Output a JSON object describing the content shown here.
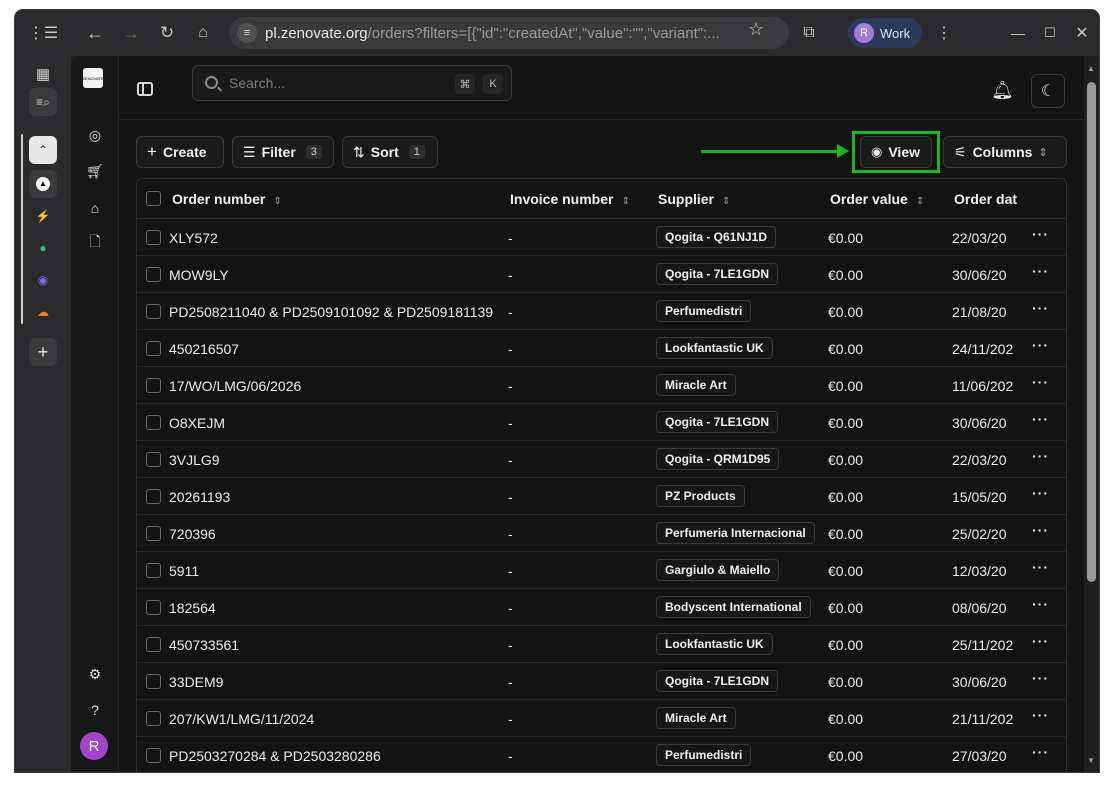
{
  "browser": {
    "url_host": "pl.zenovate.org",
    "url_path": "/orders?filters=[{\"id\":\"createdAt\",\"value\":\"\",\"variant\":...",
    "profile_initial": "R",
    "profile_name": "Work"
  },
  "app": {
    "search_placeholder": "Search...",
    "kbd_cmd": "⌘",
    "kbd_k": "K",
    "user_initial": "R"
  },
  "toolbar": {
    "create_label": "Create",
    "filter_label": "Filter",
    "filter_count": "3",
    "sort_label": "Sort",
    "sort_count": "1",
    "view_label": "View",
    "columns_label": "Columns"
  },
  "table": {
    "headers": {
      "order_number": "Order number",
      "invoice_number": "Invoice number",
      "supplier": "Supplier",
      "order_value": "Order value",
      "order_date": "Order dat"
    },
    "rows": [
      {
        "order": "XLY572",
        "invoice": "-",
        "supplier": "Qogita - Q61NJ1D",
        "value": "€0.00",
        "date": "22/03/20"
      },
      {
        "order": "MOW9LY",
        "invoice": "-",
        "supplier": "Qogita - 7LE1GDN",
        "value": "€0.00",
        "date": "30/06/20"
      },
      {
        "order": "PD2508211040 & PD2509101092 & PD2509181139",
        "invoice": "-",
        "supplier": "Perfumedistri",
        "value": "€0.00",
        "date": "21/08/20"
      },
      {
        "order": "450216507",
        "invoice": "-",
        "supplier": "Lookfantastic UK",
        "value": "€0.00",
        "date": "24/11/202"
      },
      {
        "order": "17/WO/LMG/06/2026",
        "invoice": "-",
        "supplier": "Miracle Art",
        "value": "€0.00",
        "date": "11/06/202"
      },
      {
        "order": "O8XEJM",
        "invoice": "-",
        "supplier": "Qogita - 7LE1GDN",
        "value": "€0.00",
        "date": "30/06/20"
      },
      {
        "order": "3VJLG9",
        "invoice": "-",
        "supplier": "Qogita - QRM1D95",
        "value": "€0.00",
        "date": "22/03/20"
      },
      {
        "order": "20261193",
        "invoice": "-",
        "supplier": "PZ Products",
        "value": "€0.00",
        "date": "15/05/20"
      },
      {
        "order": "720396",
        "invoice": "-",
        "supplier": "Perfumeria Internacional",
        "value": "€0.00",
        "date": "25/02/20"
      },
      {
        "order": "5911",
        "invoice": "-",
        "supplier": "Gargiulo & Maiello",
        "value": "€0.00",
        "date": "12/03/20"
      },
      {
        "order": "182564",
        "invoice": "-",
        "supplier": "Bodyscent International",
        "value": "€0.00",
        "date": "08/06/20"
      },
      {
        "order": "450733561",
        "invoice": "-",
        "supplier": "Lookfantastic UK",
        "value": "€0.00",
        "date": "25/11/202"
      },
      {
        "order": "33DEM9",
        "invoice": "-",
        "supplier": "Qogita - 7LE1GDN",
        "value": "€0.00",
        "date": "30/06/20"
      },
      {
        "order": "207/KW1/LMG/11/2024",
        "invoice": "-",
        "supplier": "Miracle Art",
        "value": "€0.00",
        "date": "21/11/202"
      },
      {
        "order": "PD2503270284 & PD2503280286",
        "invoice": "-",
        "supplier": "Perfumedistri",
        "value": "€0.00",
        "date": "27/03/20"
      }
    ]
  },
  "annotation": {
    "highlight_color": "#1bb61b"
  }
}
